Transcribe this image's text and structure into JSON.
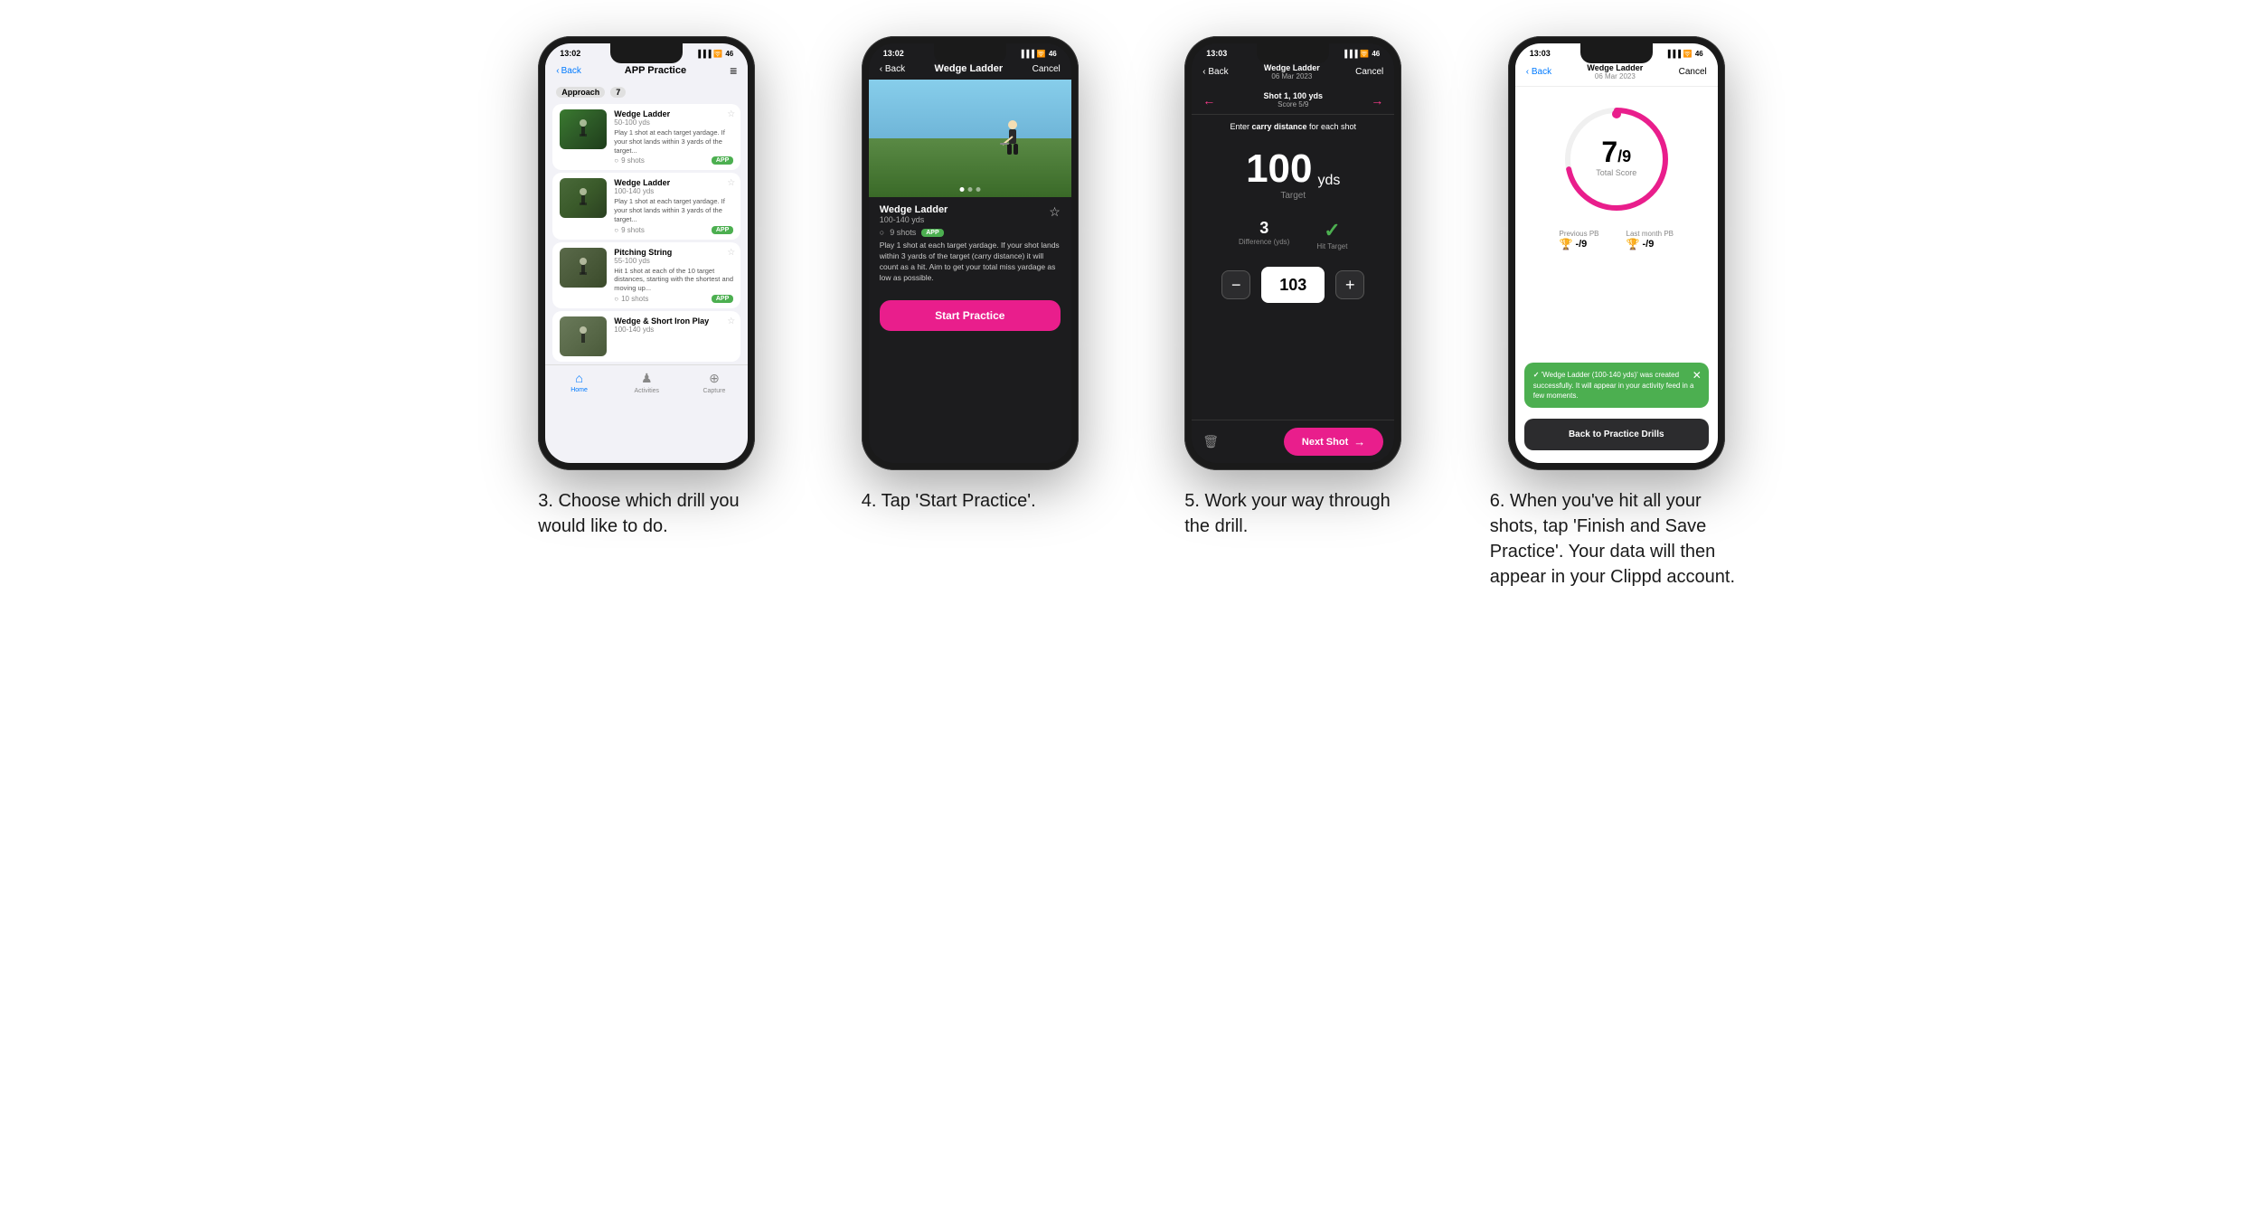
{
  "page": {
    "background": "#ffffff"
  },
  "phones": [
    {
      "id": "phone1",
      "number": "3",
      "caption": "3. Choose which drill you would like to do.",
      "statusTime": "13:02",
      "navBack": "Back",
      "navTitle": "APP Practice",
      "category": "Approach",
      "categoryCount": "7",
      "drills": [
        {
          "title": "Wedge Ladder",
          "yardage": "50-100 yds",
          "desc": "Play 1 shot at each target yardage. If your shot lands within 3 yards of the target...",
          "shots": "9 shots",
          "hasBadge": true
        },
        {
          "title": "Wedge Ladder",
          "yardage": "100-140 yds",
          "desc": "Play 1 shot at each target yardage. If your shot lands within 3 yards of the target...",
          "shots": "9 shots",
          "hasBadge": true
        },
        {
          "title": "Pitching String",
          "yardage": "55-100 yds",
          "desc": "Hit 1 shot at each of the 10 target distances, starting with the shortest and moving up...",
          "shots": "10 shots",
          "hasBadge": true
        },
        {
          "title": "Wedge & Short Iron Play",
          "yardage": "100-140 yds",
          "desc": "",
          "shots": "",
          "hasBadge": false
        }
      ],
      "bottomNav": [
        {
          "label": "Home",
          "icon": "🏠",
          "active": true
        },
        {
          "label": "Activities",
          "icon": "🏃",
          "active": false
        },
        {
          "label": "Capture",
          "icon": "➕",
          "active": false
        }
      ]
    },
    {
      "id": "phone2",
      "number": "4",
      "caption": "4. Tap 'Start Practice'.",
      "statusTime": "13:02",
      "navBack": "Back",
      "navTitle": "Wedge Ladder",
      "navCancel": "Cancel",
      "drillTitle": "Wedge Ladder",
      "drillYardage": "100-140 yds",
      "shotsCount": "9 shots",
      "drillDesc": "Play 1 shot at each target yardage. If your shot lands within 3 yards of the target (carry distance) it will count as a hit. Aim to get your total miss yardage as low as possible.",
      "startButton": "Start Practice"
    },
    {
      "id": "phone3",
      "number": "5",
      "caption": "5. Work your way through the drill.",
      "statusTime": "13:03",
      "navBack": "Back",
      "navTitleTop": "Wedge Ladder",
      "navTitleSub": "06 Mar 2023",
      "navCancel": "Cancel",
      "shotLabel": "Shot 1, 100 yds",
      "scoreLabel": "Score 5/9",
      "carryLabel": "Enter carry distance for each shot",
      "targetDistance": "100",
      "targetUnit": "yds",
      "targetText": "Target",
      "difference": "3",
      "differenceLabel": "Difference (yds)",
      "hitTarget": "Hit Target",
      "inputValue": "103",
      "nextShotLabel": "Next Shot"
    },
    {
      "id": "phone4",
      "number": "6",
      "caption": "6. When you've hit all your shots, tap 'Finish and Save Practice'. Your data will then appear in your Clippd account.",
      "statusTime": "13:03",
      "navBack": "Back",
      "navTitleTop": "Wedge Ladder",
      "navTitleSub": "06 Mar 2023",
      "navCancel": "Cancel",
      "scoreNumerator": "7",
      "scoreDenominator": "/9",
      "scoreSublabel": "Total Score",
      "previousPBLabel": "Previous PB",
      "previousPBValue": "-/9",
      "lastMonthPBLabel": "Last month PB",
      "lastMonthPBValue": "-/9",
      "toastMessage": "'Wedge Ladder (100-140 yds)' was created successfully. It will appear in your activity feed in a few moments.",
      "backButton": "Back to Practice Drills"
    }
  ]
}
